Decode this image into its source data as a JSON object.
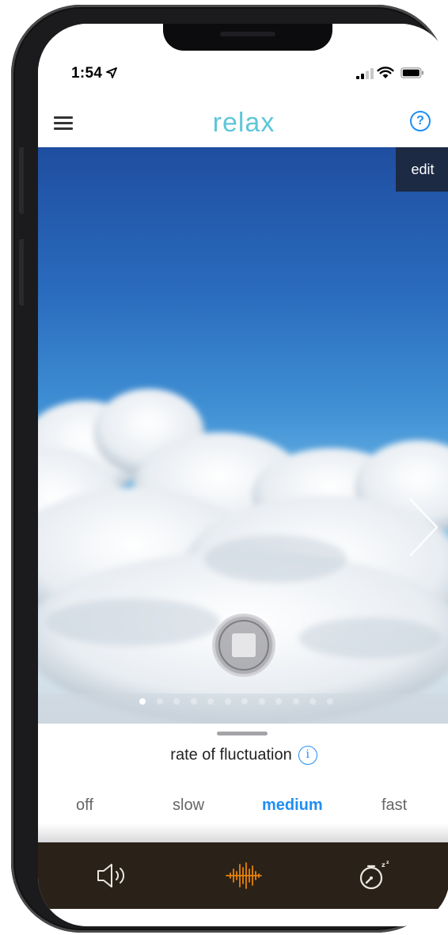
{
  "status_bar": {
    "time": "1:54",
    "icons": [
      "location-arrow-icon",
      "signal-icon",
      "wifi-icon",
      "battery-icon"
    ]
  },
  "nav": {
    "menu_icon": "hamburger-icon",
    "title": "relax",
    "help_icon": "question-mark-icon",
    "help_glyph": "?"
  },
  "hero": {
    "edit_label": "edit",
    "next_icon": "chevron-right-icon",
    "playback_icon": "stop-icon",
    "page_count": 12,
    "current_page": 1
  },
  "fluctuation": {
    "label": "rate of fluctuation",
    "info_glyph": "i",
    "options": [
      "off",
      "slow",
      "medium",
      "fast"
    ],
    "selected": "medium"
  },
  "toolbar": {
    "items": [
      "volume-icon",
      "waveform-icon",
      "sleep-timer-icon"
    ],
    "active": "waveform-icon"
  },
  "colors": {
    "title": "#5ec6d8",
    "accent": "#1f8ef3",
    "toolbar_bg": "#2a2218",
    "toolbar_active": "#e8820c",
    "edit_bg": "#1c2a44"
  }
}
